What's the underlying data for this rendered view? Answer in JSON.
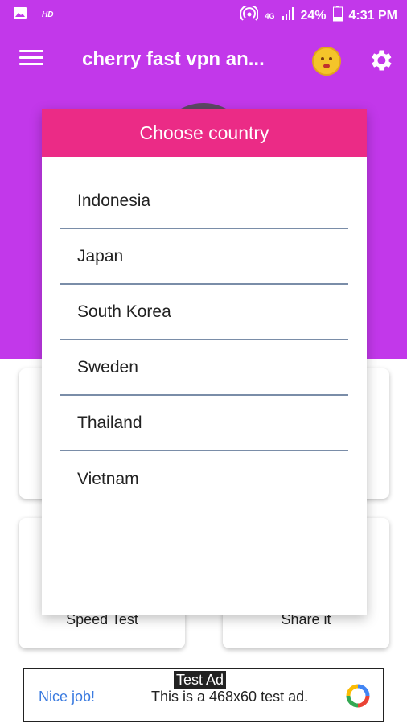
{
  "status_bar": {
    "hd": "HD",
    "network": "4G",
    "battery": "24%",
    "time": "4:31 PM"
  },
  "app_bar": {
    "title": "cherry fast vpn an..."
  },
  "dialog": {
    "title": "Choose country",
    "countries": [
      "Indonesia",
      "Japan",
      "South Korea",
      "Sweden",
      "Thailand",
      "Vietnam"
    ]
  },
  "cards": {
    "speed_test": "Speed Test",
    "share_it": "Share it"
  },
  "ad": {
    "tag": "Test Ad",
    "headline": "Nice job!",
    "body": "This is a 468x60 test ad."
  },
  "colors": {
    "primary": "#c238ea",
    "dialog_header": "#eb2b86",
    "divider": "#7a8da8",
    "ad_link": "#3b7be0"
  }
}
